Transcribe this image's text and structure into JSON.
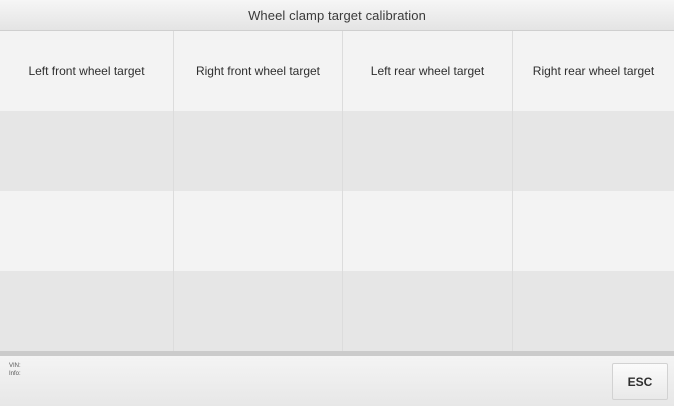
{
  "titlebar": {
    "title": "Wheel clamp target calibration"
  },
  "table": {
    "columns": [
      "Left front wheel target",
      "Right front wheel target",
      "Left rear wheel target",
      "Right rear wheel target"
    ],
    "rows": [
      [
        "",
        "",
        "",
        ""
      ],
      [
        "",
        "",
        "",
        ""
      ],
      [
        "",
        "",
        "",
        ""
      ]
    ]
  },
  "footer": {
    "vin_label": "VIN:",
    "info_label": "Info:",
    "esc_label": "ESC"
  },
  "colors": {
    "header_row_bg": "#f3f3f3",
    "alt_row_bg": "#e6e6e6",
    "footer_separator": "#cbcbcb"
  }
}
